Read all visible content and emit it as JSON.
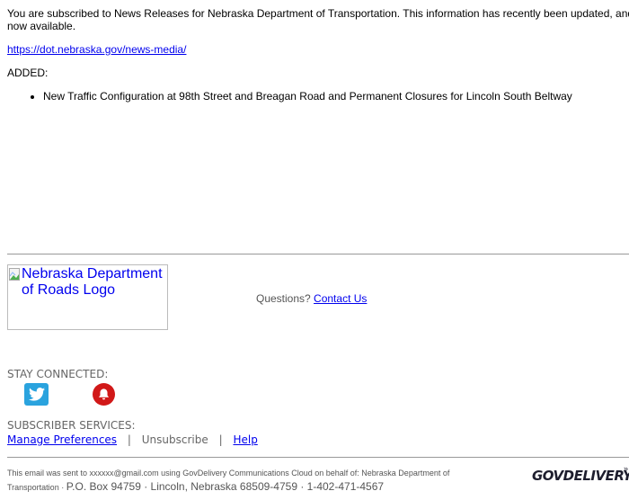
{
  "intro": {
    "text": "You are subscribed to News Releases for Nebraska Department of Transportation. This information has recently been updated, and is now available."
  },
  "link": {
    "url_text": "https://dot.nebraska.gov/news-media/"
  },
  "added": {
    "label": "ADDED:",
    "items": [
      "New Traffic Configuration at 98th Street and Breagan Road and Permanent Closures for Lincoln South Beltway"
    ]
  },
  "logo": {
    "alt_text": "Nebraska Department of Roads Logo"
  },
  "questions": {
    "label": "Questions?",
    "contact_link": "Contact Us"
  },
  "stay_connected": {
    "label": "STAY CONNECTED:",
    "icons": [
      "twitter-icon",
      "notification-bell-icon"
    ]
  },
  "subscriber_services": {
    "label": "SUBSCRIBER SERVICES:",
    "manage": "Manage Preferences",
    "separator": "|",
    "unsubscribe": "Unsubscribe",
    "help": "Help"
  },
  "footer": {
    "line1": "This email was sent to xxxxxx@gmail.com using GovDelivery Communications Cloud on behalf of: Nebraska Department of",
    "line2_small": "Transportation · ",
    "line2_large": "P.O. Box 94759 · Lincoln, Nebraska 68509-4759 · 1-402-471-4567",
    "brand": "GOVDELIVERY"
  }
}
